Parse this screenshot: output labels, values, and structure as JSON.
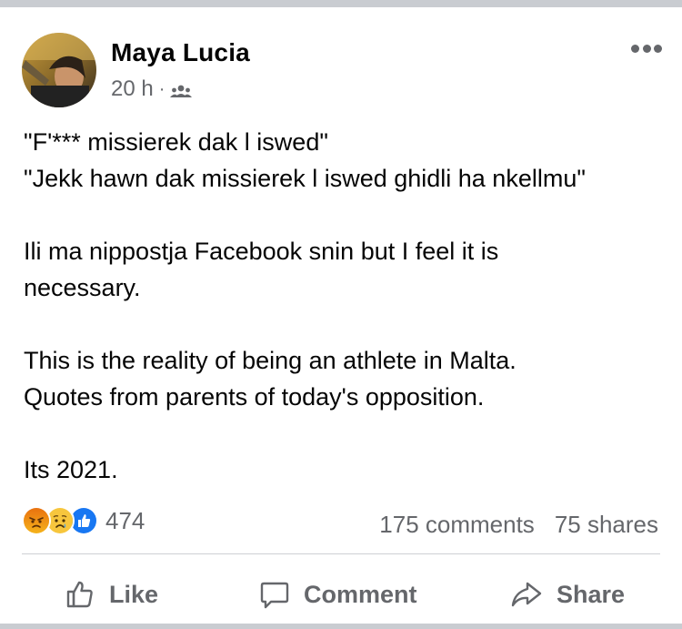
{
  "post": {
    "author": "Maya Lucia",
    "time": "20 h",
    "separator": "·",
    "audience_icon": "friends-icon",
    "more_icon": "more-horizontal-icon",
    "body_lines": [
      "\"F'*** missierek dak l iswed\"",
      "\"Jekk hawn dak missierek l iswed ghidli ha nkellmu\"",
      "",
      "Ili ma nippostja Facebook snin but I feel it is",
      "necessary.",
      "",
      "This is the reality of being an athlete in Malta.",
      "Quotes from parents of today's opposition.",
      "",
      "Its 2021."
    ]
  },
  "reactions": {
    "icons": [
      "angry-reaction-icon",
      "sad-reaction-icon",
      "like-reaction-icon"
    ],
    "count": "474"
  },
  "stats": {
    "comments": "175 comments",
    "shares": "75 shares"
  },
  "actions": {
    "like": "Like",
    "comment": "Comment",
    "share": "Share"
  },
  "colors": {
    "text_primary": "#050505",
    "text_secondary": "#65676b",
    "divider": "#ced0d4",
    "like_blue": "#1877f2",
    "angry_top": "#e9710f",
    "angry_bottom": "#f5b31b",
    "sad_yellow": "#f7c63d"
  }
}
